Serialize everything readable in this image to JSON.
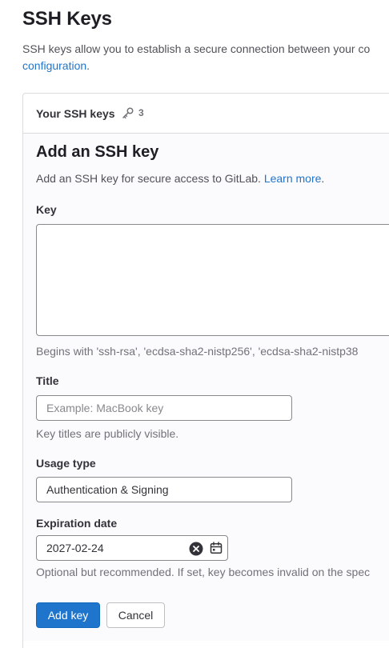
{
  "page": {
    "title": "SSH Keys",
    "intro_line1": "SSH keys allow you to establish a secure connection between your co",
    "intro_link": "configuration",
    "intro_end": "."
  },
  "card": {
    "header_title": "Your SSH keys",
    "key_count": "3",
    "key_count_icon": "key-icon"
  },
  "form": {
    "title": "Add an SSH key",
    "description": "Add an SSH key for secure access to GitLab. ",
    "learn_more": "Learn more",
    "description_end": ".",
    "key_label": "Key",
    "key_value": "",
    "key_help": "Begins with 'ssh-rsa', 'ecdsa-sha2-nistp256', 'ecdsa-sha2-nistp38",
    "title_label": "Title",
    "title_placeholder": "Example: MacBook key",
    "title_help": "Key titles are publicly visible.",
    "usage_label": "Usage type",
    "usage_value": "Authentication & Signing",
    "expiration_label": "Expiration date",
    "expiration_value": "2027-02-24",
    "expiration_help": "Optional but recommended. If set, key becomes invalid on the spec",
    "add_button": "Add key",
    "cancel_button": "Cancel"
  },
  "colors": {
    "link": "#1f75cb",
    "primary_button": "#1f75cb"
  }
}
